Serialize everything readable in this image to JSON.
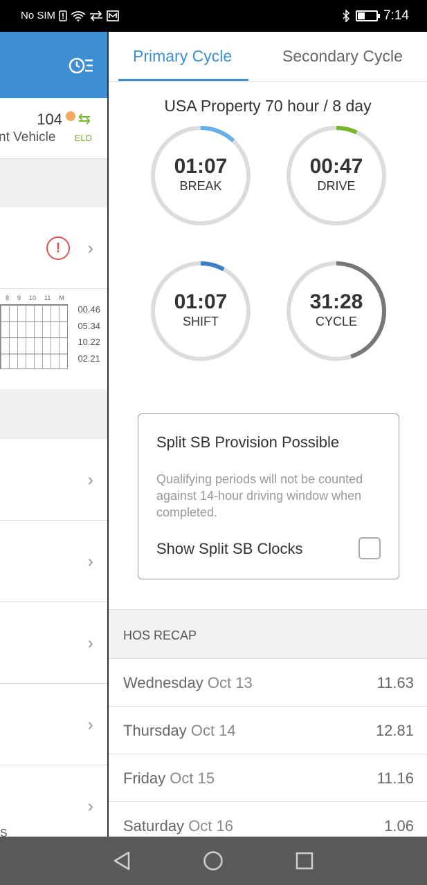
{
  "status_bar": {
    "carrier": "No SIM",
    "time": "7:14"
  },
  "left_panel": {
    "vehicle_number": "104",
    "vehicle_text": "nt Vehicle",
    "eld_label": "ELD",
    "graph_hours": [
      "8",
      "9",
      "10",
      "11",
      "M"
    ],
    "graph_totals": [
      "00.46",
      "05.34",
      "10.22",
      "02.21"
    ],
    "footer_text": "S"
  },
  "tabs": {
    "primary": "Primary Cycle",
    "secondary": "Secondary Cycle"
  },
  "cycle_title": "USA Property 70 hour / 8 day",
  "gauges": {
    "break": {
      "time": "01:07",
      "label": "BREAK",
      "progress": 0.12,
      "color": "#6aaee8"
    },
    "drive": {
      "time": "00:47",
      "label": "DRIVE",
      "progress": 0.07,
      "color": "#76b82a"
    },
    "shift": {
      "time": "01:07",
      "label": "SHIFT",
      "progress": 0.08,
      "color": "#3a7fc4"
    },
    "cycle": {
      "time": "31:28",
      "label": "CYCLE",
      "progress": 0.45,
      "color": "#777777"
    }
  },
  "split_sb": {
    "title": "Split SB Provision Possible",
    "description": "Qualifying periods will not be counted against 14-hour driving window when completed.",
    "option_label": "Show Split SB Clocks"
  },
  "recap": {
    "header": "HOS RECAP",
    "rows": [
      {
        "day": "Wednesday",
        "date": "Oct 13",
        "value": "11.63"
      },
      {
        "day": "Thursday",
        "date": "Oct 14",
        "value": "12.81"
      },
      {
        "day": "Friday",
        "date": "Oct 15",
        "value": "11.16"
      },
      {
        "day": "Saturday",
        "date": "Oct 16",
        "value": "1.06"
      }
    ]
  },
  "icons": {
    "clock_menu": "clock-list-icon",
    "alert": "alert-icon",
    "chevron": "chevron-right-icon",
    "swap": "swap-arrows-icon",
    "nav_back": "back-triangle-icon",
    "nav_home": "home-circle-icon",
    "nav_recents": "recents-square-icon"
  }
}
